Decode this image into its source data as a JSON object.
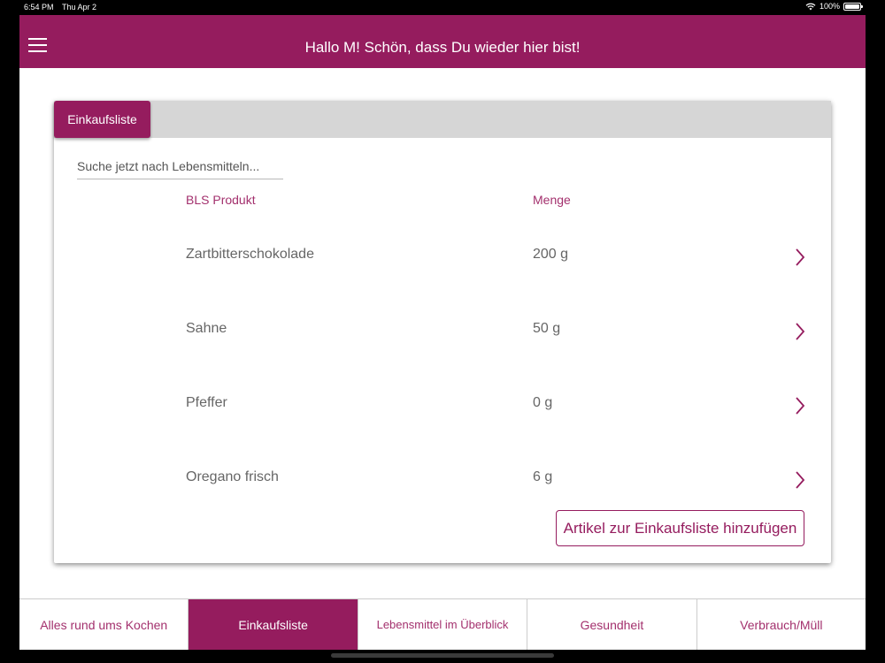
{
  "status": {
    "time": "6:54 PM",
    "date": "Thu Apr 2",
    "battery": "100%"
  },
  "header": {
    "title": "Hallo M! Schön, dass Du wieder hier bist!"
  },
  "card": {
    "tab_label": "Einkaufsliste",
    "search_placeholder": "Suche jetzt nach Lebensmitteln...",
    "columns": {
      "product": "BLS Produkt",
      "quantity": "Menge"
    },
    "items": [
      {
        "name": "Zartbitterschokolade",
        "qty": "200 g"
      },
      {
        "name": "Sahne",
        "qty": "50 g"
      },
      {
        "name": "Pfeffer",
        "qty": "0 g"
      },
      {
        "name": "Oregano frisch",
        "qty": "6 g"
      }
    ],
    "add_button": "Artikel zur Einkaufsliste hinzufügen"
  },
  "tabs": [
    {
      "label": "Alles rund ums Kochen",
      "active": false
    },
    {
      "label": "Einkaufsliste",
      "active": true
    },
    {
      "label": "Lebensmittel im Überblick",
      "active": false
    },
    {
      "label": "Gesundheit",
      "active": false
    },
    {
      "label": "Verbrauch/Müll",
      "active": false
    }
  ],
  "colors": {
    "brand": "#951c5e",
    "accent_text": "#a3306d"
  },
  "icons": {
    "menu": "hamburger-icon",
    "row_action": "chevron-right-icon",
    "wifi": "wifi-icon",
    "battery": "battery-icon"
  }
}
